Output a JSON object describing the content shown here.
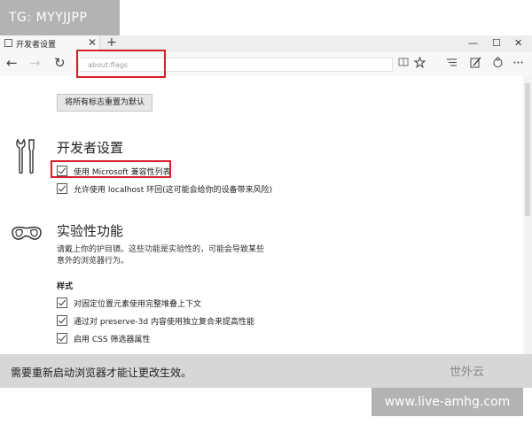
{
  "watermarks": {
    "top_left": "TG: MYYJJPP",
    "bottom_right": "www.live-amhg.com"
  },
  "browser": {
    "tab_title": "开发者设置",
    "tab_close": "✕",
    "new_tab": "+",
    "window_controls": {
      "minimize": "—",
      "maximize": "☐",
      "close": "✕"
    },
    "nav": {
      "back": "←",
      "forward": "→",
      "refresh": "↻"
    },
    "url": "about:flags",
    "toolbar_icons": [
      "reading-view-icon",
      "favorites-star-icon",
      "hub-icon",
      "web-note-icon",
      "share-icon",
      "more-icon"
    ]
  },
  "page": {
    "reset_button": "将所有标志重置为默认",
    "developer_section": {
      "title": "开发者设置",
      "options": [
        {
          "label": "使用 Microsoft 兼容性列表",
          "checked": true
        },
        {
          "label": "允许使用 localhost 环回(这可能会给你的设备带来风险)",
          "checked": true
        }
      ]
    },
    "experimental_section": {
      "title": "实验性功能",
      "description": "请戴上你的护目镜。这些功能是实验性的，可能会导致某些意外的浏览器行为。",
      "subheading": "样式",
      "options": [
        {
          "label": "对固定位置元素使用完整堆叠上下文",
          "checked": true
        },
        {
          "label": "通过对 preserve-3d 内容使用独立复合来提高性能",
          "checked": true
        },
        {
          "label": "启用 CSS 筛选器属性",
          "checked": true
        }
      ]
    }
  },
  "notice": {
    "text": "需要重新启动浏览器才能让更改生效。",
    "brand": "世外云"
  },
  "colors": {
    "annotation_red": "#d51f2a",
    "notice_bg": "#d7d7d7",
    "watermark_bg": "#b3b3b3"
  }
}
